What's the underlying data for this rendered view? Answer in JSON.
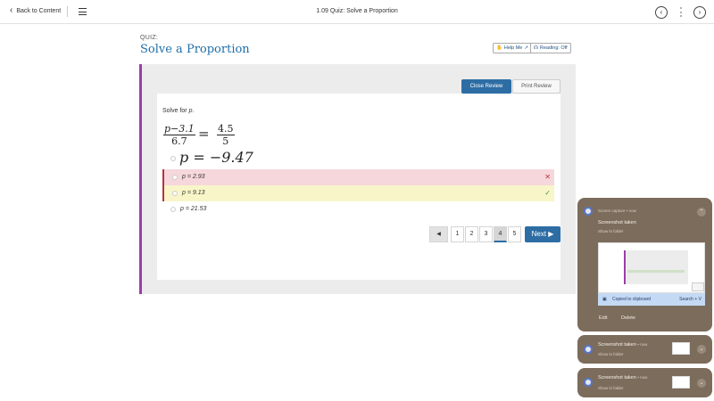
{
  "topbar": {
    "back_label": "Back to Content",
    "title": "1.09 Quiz: Solve a Proportion"
  },
  "quiz": {
    "label": "QUIZ:",
    "name": "Solve a Proportion",
    "help_label": "Help Me",
    "reading_label": "Reading: Off"
  },
  "review": {
    "close_label": "Close Review",
    "print_label": "Print Review"
  },
  "question": {
    "prompt_text": "Solve for ",
    "prompt_var": "p",
    "prompt_end": ".",
    "left_num": "p−3.1",
    "left_den": "6.7",
    "eq": "=",
    "right_num": "4.5",
    "right_den": "5",
    "answer_big": "p = −9.47",
    "options": [
      {
        "label": "p = 2.93",
        "state": "wrong",
        "mark": "✕"
      },
      {
        "label": "p = 9.13",
        "state": "correct",
        "mark": "✓"
      },
      {
        "label": "p = 21.53",
        "state": "none",
        "mark": ""
      }
    ]
  },
  "pager": {
    "prev_icon": "◀",
    "pages": [
      "1",
      "2",
      "3",
      "4",
      "5"
    ],
    "current": "4",
    "next_label": "Next ▶"
  },
  "notifications": {
    "first_meta": "Screen capture • now",
    "first_title": "Screenshot taken",
    "first_sub": "Show in folder",
    "copied_label": "Copied to clipboard",
    "copied_shortcut": "Search + V",
    "edit_label": "Edit",
    "delete_label": "Delete",
    "second_title": "Screenshot taken",
    "second_time": "• now",
    "second_sub": "Show in folder",
    "third_title": "Screenshot taken",
    "third_time": "• now",
    "third_sub": "Show in folder"
  },
  "colors": {
    "accent": "#2e6da4",
    "title_blue": "#1f6ea8",
    "panel_border": "#9b3fa6",
    "wrong_bg": "#f6d7db",
    "correct_bg": "#f8f6c8",
    "notif_bg": "#7c6c5c"
  }
}
